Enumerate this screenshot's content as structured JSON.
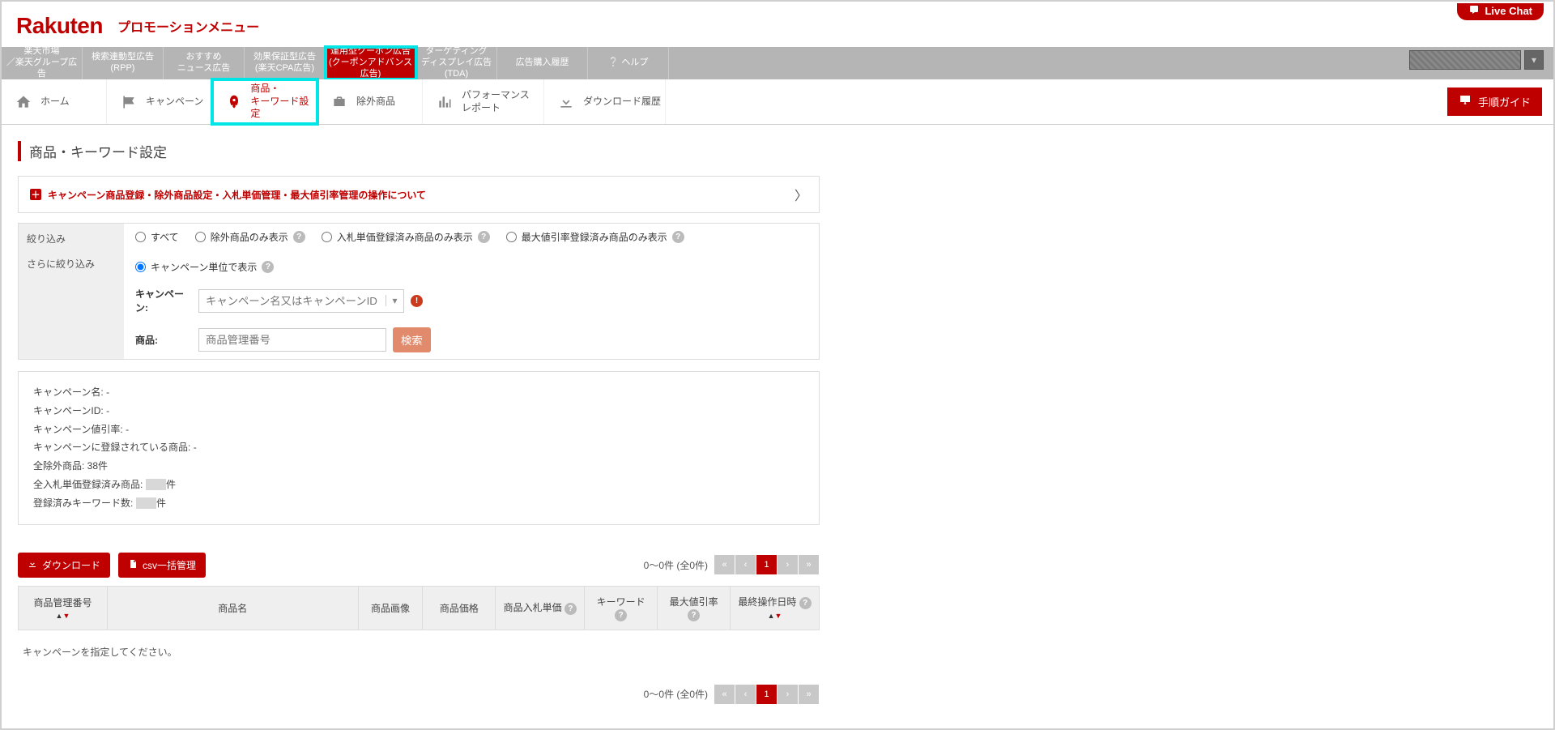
{
  "livechat": "Live Chat",
  "header": {
    "logo": "Rakuten",
    "subtitle": "プロモーションメニュー"
  },
  "topnav": [
    {
      "l1": "楽天市場",
      "l2": "／楽天グループ広告"
    },
    {
      "l1": "検索連動型広告",
      "l2": "(RPP)"
    },
    {
      "l1": "おすすめ",
      "l2": "ニュース広告"
    },
    {
      "l1": "効果保証型広告",
      "l2": "(楽天CPA広告)"
    },
    {
      "l1": "運用型クーポン広告",
      "l2": "(クーポンアドバンス",
      "l3": "広告)"
    },
    {
      "l1": "ターゲティング",
      "l2": "ディスプレイ広告",
      "l3": "(TDA)"
    },
    {
      "l1": "広告購入履歴",
      "l2": ""
    },
    {
      "l1": "❔ ヘルプ",
      "l2": ""
    }
  ],
  "subnav": [
    {
      "label": "ホーム"
    },
    {
      "label": "キャンペーン"
    },
    {
      "label": "商品・\nキーワード設定"
    },
    {
      "label": "除外商品"
    },
    {
      "label": "パフォーマンス\nレポート"
    },
    {
      "label": "ダウンロード履歴"
    }
  ],
  "guide_button": "手順ガイド",
  "page_title": "商品・キーワード設定",
  "info_bar": "キャンペーン商品登録・除外商品設定・入札単価管理・最大値引率管理の操作について",
  "filter": {
    "label1": "絞り込み",
    "label2": "さらに絞り込み",
    "radios": [
      "すべて",
      "除外商品のみ表示",
      "入札単価登録済み商品のみ表示",
      "最大値引率登録済み商品のみ表示",
      "キャンペーン単位で表示"
    ],
    "campaign_label": "キャンペーン:",
    "campaign_placeholder": "キャンペーン名又はキャンペーンID",
    "product_label": "商品:",
    "product_placeholder": "商品管理番号",
    "search": "検索"
  },
  "summary": {
    "camp_name": "キャンペーン名: -",
    "camp_id": "キャンペーンID: -",
    "camp_rate": "キャンペーン値引率: -",
    "camp_prod": "キャンペーンに登録されている商品: -",
    "all_excl": "全除外商品: 38件",
    "all_bid_lbl": "全入札単価登録済み商品: ",
    "all_bid_unit": "件",
    "kw_lbl": "登録済みキーワード数: ",
    "kw_unit": "件"
  },
  "actions": {
    "download": "ダウンロード",
    "csv": "csv一括管理"
  },
  "pager": {
    "text": "0〜0件 (全0件)",
    "page": "1"
  },
  "table": {
    "headers": [
      "商品管理番号",
      "商品名",
      "商品画像",
      "商品価格",
      "商品入札単価",
      "キーワード",
      "最大値引率",
      "最終操作日時"
    ],
    "empty_msg": "キャンペーンを指定してください。"
  }
}
